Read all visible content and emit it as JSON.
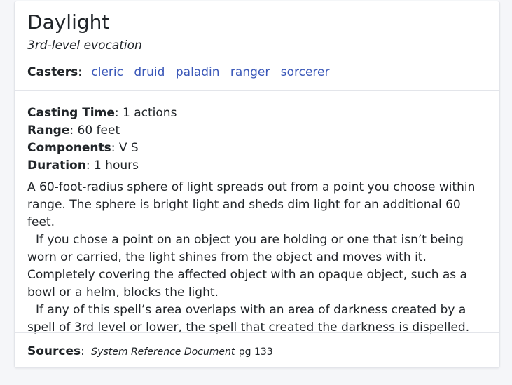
{
  "spell": {
    "name": "Daylight",
    "level_school": "3rd-level evocation",
    "casters_label": "Casters",
    "casters": [
      "cleric",
      "druid",
      "paladin",
      "ranger",
      "sorcerer"
    ],
    "stats": {
      "casting_time_label": "Casting Time",
      "casting_time": "1 actions",
      "range_label": "Range",
      "range": "60 feet",
      "components_label": "Components",
      "components": "V S",
      "duration_label": "Duration",
      "duration": "1 hours"
    },
    "description": [
      "A 60-foot-radius sphere of light spreads out from a point you choose within range. The sphere is bright light and sheds dim light for an additional 60 feet.",
      "If you chose a point on an object you are holding or one that isn’t being worn or carried, the light shines from the object and moves with it. Completely covering the affected object with an opaque object, such as a bowl or a helm, blocks the light.",
      "If any of this spell’s area overlaps with an area of darkness created by a spell of 3rd level or lower, the spell that created the darkness is dispelled."
    ],
    "sources_label": "Sources",
    "source_document": "System Reference Document",
    "source_page": "pg 133"
  },
  "colors": {
    "link": "#3a57b8",
    "border": "#e3e5ea",
    "background": "#f5f6f9"
  }
}
